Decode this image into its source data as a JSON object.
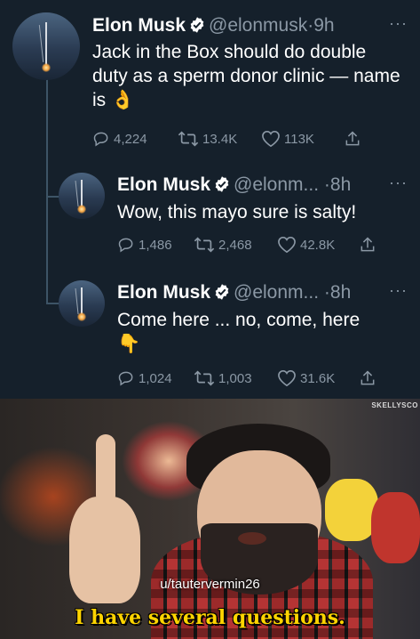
{
  "tweets": [
    {
      "name": "Elon Musk",
      "handle": "@elonmusk",
      "sep": "·",
      "time": "9h",
      "text": "Jack in the Box should do double duty as a sperm donor clinic — name is 👌",
      "replies": "4,224",
      "retweets": "13.4K",
      "likes": "113K"
    },
    {
      "name": "Elon Musk",
      "handle": "@elonm...",
      "sep": "·",
      "time": "8h",
      "text": "Wow, this mayo sure is salty!",
      "replies": "1,486",
      "retweets": "2,468",
      "likes": "42.8K"
    },
    {
      "name": "Elon Musk",
      "handle": "@elonm...",
      "sep": "·",
      "time": "8h",
      "text": "Come here ... no, come, here 👇",
      "replies": "1,024",
      "retweets": "1,003",
      "likes": "31.6K"
    }
  ],
  "more_glyph": "···",
  "icons": [
    "verified-badge-icon",
    "reply-icon",
    "retweet-icon",
    "like-icon",
    "share-icon",
    "more-icon"
  ],
  "colors": {
    "background": "#15202b",
    "text": "#ffffff",
    "muted": "#8b98a5",
    "verified": "#ffffff",
    "caption": "#ffd400"
  },
  "meme": {
    "watermark": "SKELLYSCO",
    "username": "u/tautervermin26",
    "caption": "I have several questions."
  }
}
